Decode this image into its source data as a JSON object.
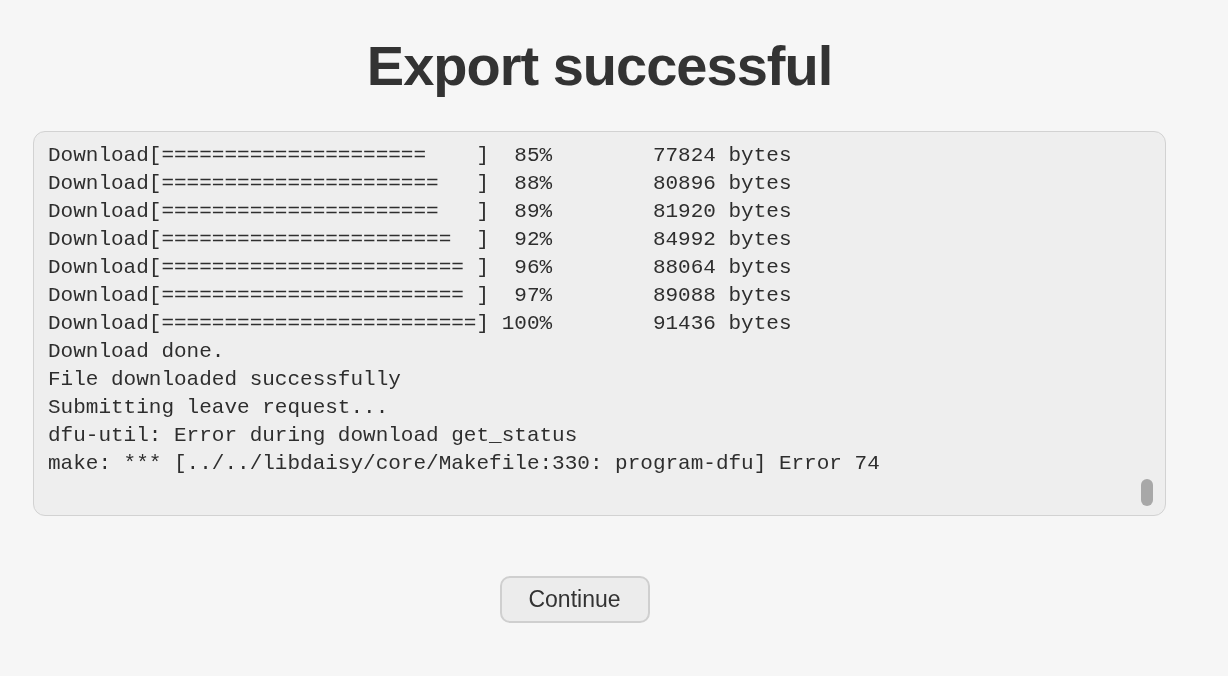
{
  "title": "Export successful",
  "console": {
    "lines": [
      "Download[=====================    ]  85%        77824 bytes",
      "Download[======================   ]  88%        80896 bytes",
      "Download[======================   ]  89%        81920 bytes",
      "Download[=======================  ]  92%        84992 bytes",
      "Download[======================== ]  96%        88064 bytes",
      "Download[======================== ]  97%        89088 bytes",
      "Download[=========================] 100%        91436 bytes",
      "Download done.",
      "File downloaded successfully",
      "Submitting leave request...",
      "dfu-util: Error during download get_status",
      "make: *** [../../libdaisy/core/Makefile:330: program-dfu] Error 74"
    ]
  },
  "button": {
    "label": "Continue"
  }
}
